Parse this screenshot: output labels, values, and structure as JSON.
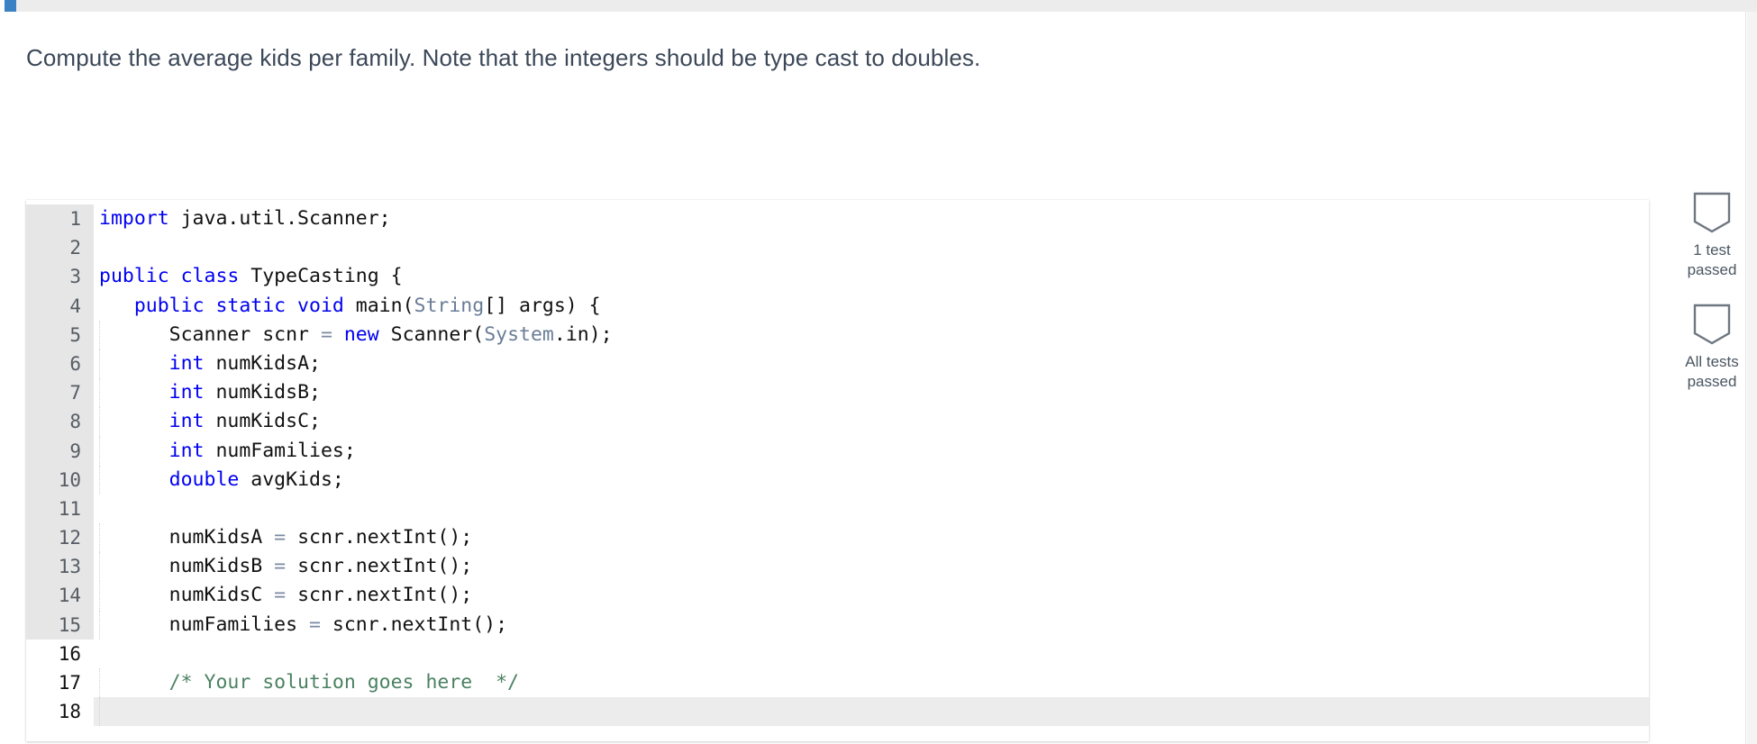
{
  "window": {
    "tab_marker_color": "#3b82c4",
    "top_strip_color": "#ececec"
  },
  "instruction": {
    "text": "Compute the average kids per family. Note that the integers should be type cast to doubles."
  },
  "editor": {
    "language": "java",
    "first_line_number": 1,
    "last_line_number": 18,
    "current_line": 18,
    "editable_from_line": 16,
    "colors": {
      "keyword": "#0000f0",
      "type": "#6a7d96",
      "operator": "#7b89a0",
      "comment": "#4b8161",
      "plain": "#111111",
      "gutter_readonly_bg": "#e6e6e6",
      "gutter_editable_bg": "#ffffff",
      "current_line_bg": "#ececec"
    },
    "lines": [
      {
        "n": "1",
        "tokens": [
          {
            "t": "import",
            "c": "kw"
          },
          {
            "t": " java.util.Scanner;",
            "c": "pln"
          }
        ],
        "readonly": true,
        "indent_guide": false
      },
      {
        "n": "2",
        "tokens": [],
        "readonly": true,
        "indent_guide": false
      },
      {
        "n": "3",
        "tokens": [
          {
            "t": "public class",
            "c": "kw"
          },
          {
            "t": " TypeCasting {",
            "c": "pln"
          }
        ],
        "readonly": true,
        "indent_guide": false
      },
      {
        "n": "4",
        "tokens": [
          {
            "t": "   ",
            "c": "pln"
          },
          {
            "t": "public static void",
            "c": "kw"
          },
          {
            "t": " main(",
            "c": "pln"
          },
          {
            "t": "String",
            "c": "typ"
          },
          {
            "t": "[] args) {",
            "c": "pln"
          }
        ],
        "readonly": true,
        "indent_guide": false
      },
      {
        "n": "5",
        "tokens": [
          {
            "t": "      Scanner scnr ",
            "c": "pln"
          },
          {
            "t": "=",
            "c": "op"
          },
          {
            "t": " ",
            "c": "pln"
          },
          {
            "t": "new",
            "c": "kw"
          },
          {
            "t": " Scanner(",
            "c": "pln"
          },
          {
            "t": "System",
            "c": "typ"
          },
          {
            "t": ".in);",
            "c": "pln"
          }
        ],
        "readonly": true,
        "indent_guide": true
      },
      {
        "n": "6",
        "tokens": [
          {
            "t": "      ",
            "c": "pln"
          },
          {
            "t": "int",
            "c": "kw"
          },
          {
            "t": " numKidsA;",
            "c": "pln"
          }
        ],
        "readonly": true,
        "indent_guide": true
      },
      {
        "n": "7",
        "tokens": [
          {
            "t": "      ",
            "c": "pln"
          },
          {
            "t": "int",
            "c": "kw"
          },
          {
            "t": " numKidsB;",
            "c": "pln"
          }
        ],
        "readonly": true,
        "indent_guide": true
      },
      {
        "n": "8",
        "tokens": [
          {
            "t": "      ",
            "c": "pln"
          },
          {
            "t": "int",
            "c": "kw"
          },
          {
            "t": " numKidsC;",
            "c": "pln"
          }
        ],
        "readonly": true,
        "indent_guide": true
      },
      {
        "n": "9",
        "tokens": [
          {
            "t": "      ",
            "c": "pln"
          },
          {
            "t": "int",
            "c": "kw"
          },
          {
            "t": " numFamilies;",
            "c": "pln"
          }
        ],
        "readonly": true,
        "indent_guide": true
      },
      {
        "n": "10",
        "tokens": [
          {
            "t": "      ",
            "c": "pln"
          },
          {
            "t": "double",
            "c": "kw"
          },
          {
            "t": " avgKids;",
            "c": "pln"
          }
        ],
        "readonly": true,
        "indent_guide": true
      },
      {
        "n": "11",
        "tokens": [],
        "readonly": true,
        "indent_guide": false
      },
      {
        "n": "12",
        "tokens": [
          {
            "t": "      numKidsA ",
            "c": "pln"
          },
          {
            "t": "=",
            "c": "op"
          },
          {
            "t": " scnr.nextInt();",
            "c": "pln"
          }
        ],
        "readonly": true,
        "indent_guide": true
      },
      {
        "n": "13",
        "tokens": [
          {
            "t": "      numKidsB ",
            "c": "pln"
          },
          {
            "t": "=",
            "c": "op"
          },
          {
            "t": " scnr.nextInt();",
            "c": "pln"
          }
        ],
        "readonly": true,
        "indent_guide": true
      },
      {
        "n": "14",
        "tokens": [
          {
            "t": "      numKidsC ",
            "c": "pln"
          },
          {
            "t": "=",
            "c": "op"
          },
          {
            "t": " scnr.nextInt();",
            "c": "pln"
          }
        ],
        "readonly": true,
        "indent_guide": true
      },
      {
        "n": "15",
        "tokens": [
          {
            "t": "      numFamilies ",
            "c": "pln"
          },
          {
            "t": "=",
            "c": "op"
          },
          {
            "t": " scnr.nextInt();",
            "c": "pln"
          }
        ],
        "readonly": true,
        "indent_guide": true
      },
      {
        "n": "16",
        "tokens": [],
        "readonly": false,
        "indent_guide": false
      },
      {
        "n": "17",
        "tokens": [
          {
            "t": "      ",
            "c": "pln"
          },
          {
            "t": "/* Your solution goes here  */",
            "c": "cmt"
          }
        ],
        "readonly": false,
        "indent_guide": true
      },
      {
        "n": "18",
        "tokens": [],
        "readonly": false,
        "indent_guide": true,
        "current": true
      }
    ]
  },
  "test_sidebar": {
    "items": [
      {
        "icon": "badge-icon",
        "label_line1": "1 test",
        "label_line2": "passed"
      },
      {
        "icon": "badge-icon",
        "label_line1": "All tests",
        "label_line2": "passed"
      }
    ]
  }
}
